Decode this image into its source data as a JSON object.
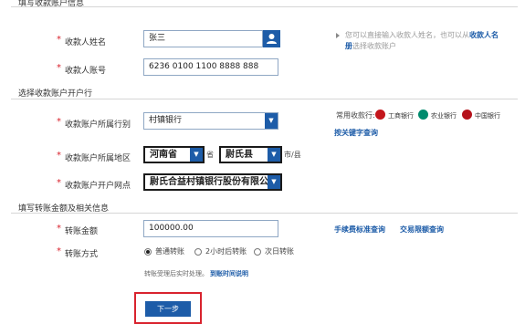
{
  "sections": {
    "payee_info": "填写收款账户信息",
    "payee_bank": "选择收款账户开户行",
    "amount_info": "填写转账金额及相关信息"
  },
  "required_mark": "*",
  "payee": {
    "name_label": "收款人姓名",
    "name_value": "张三",
    "account_label": "收款人账号",
    "account_value": "6236 0100 1100 8888 888",
    "hint_prefix": "您可以直接输入收款人姓名，也可以从",
    "hint_link": "收款人名册",
    "hint_suffix": "选择收款账户"
  },
  "bank": {
    "type_label": "收款账户所属行别",
    "type_value": "村镇银行",
    "region_label": "收款账户所属地区",
    "province_value": "河南省",
    "province_unit": "省",
    "county_value": "尉氏县",
    "county_unit": "市/县",
    "branch_label": "收款账户开户网点",
    "branch_value": "尉氏合益村镇银行股份有限公司",
    "common_banks_label": "常用收款行:",
    "common_banks": [
      {
        "name": "工商银行",
        "color": "#c4161c"
      },
      {
        "name": "农业银行",
        "color": "#008b6e"
      },
      {
        "name": "中国银行",
        "color": "#b5121b"
      }
    ],
    "keyword_search": "按关键字查询"
  },
  "transfer": {
    "amount_label": "转账金额",
    "amount_value": "100000.00",
    "fee_link": "手续费标准查询",
    "limit_link": "交易限额查询",
    "mode_label": "转账方式",
    "modes": [
      "普通转账",
      "2小时后转账",
      "次日转账"
    ],
    "note": "转账受理后实时处理。",
    "note_link": "到账时间说明"
  },
  "next_button": "下一步",
  "colors": {
    "primary": "#1d5ca8",
    "required": "#d9232e",
    "highlight_box": "#d9232e"
  }
}
